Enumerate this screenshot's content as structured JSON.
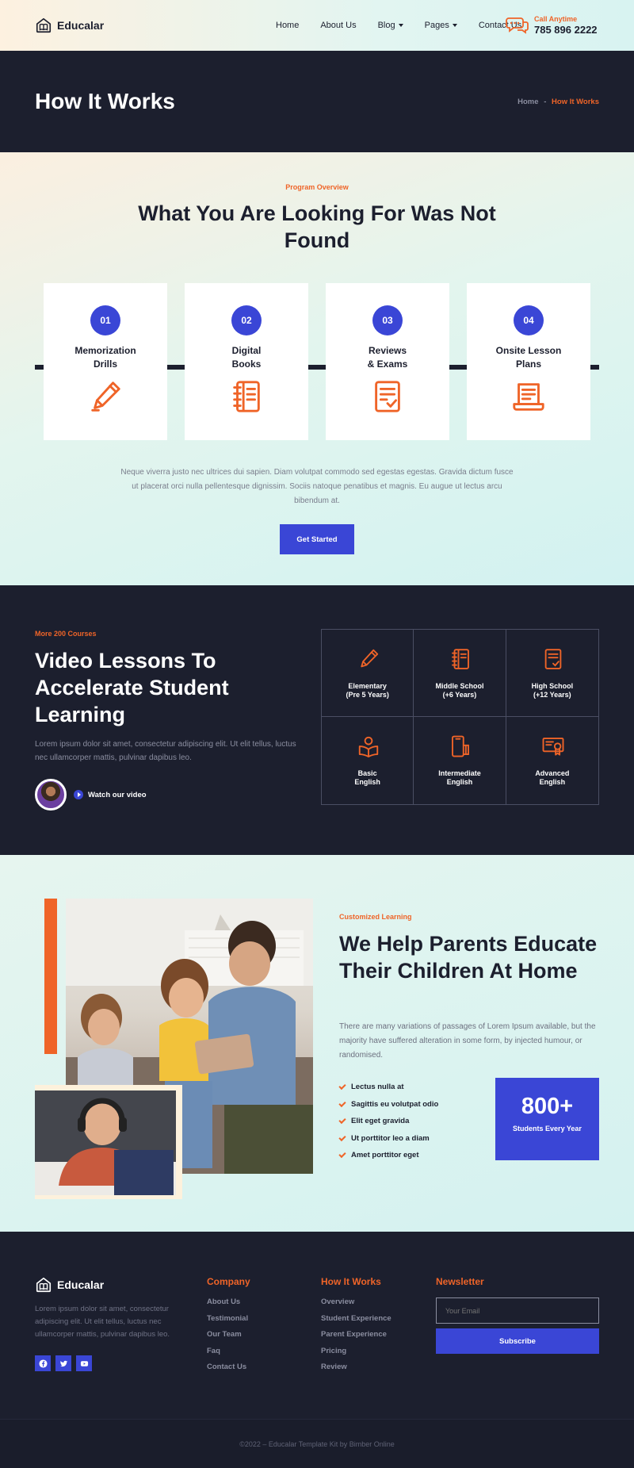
{
  "brand": {
    "name": "Educalar",
    "accent": "#ef6428",
    "primary": "#3a46d6",
    "dark": "#1c1f2e"
  },
  "nav": {
    "items": [
      {
        "label": "Home",
        "dropdown": false
      },
      {
        "label": "About Us",
        "dropdown": false
      },
      {
        "label": "Blog",
        "dropdown": true
      },
      {
        "label": "Pages",
        "dropdown": true
      },
      {
        "label": "Contact Us",
        "dropdown": false
      }
    ],
    "call_label": "Call Anytime",
    "call_number": "785 896 2222",
    "call_icon": "chat-bubbles-icon"
  },
  "hero": {
    "title": "How It Works",
    "breadcrumb_home": "Home",
    "breadcrumb_sep": "-",
    "breadcrumb_current": "How It Works"
  },
  "overview": {
    "eyebrow": "Program Overview",
    "title": "What You Are Looking For Was Not Found",
    "steps": [
      {
        "num": "01",
        "title": "Memorization Drills",
        "icon": "pencil-icon"
      },
      {
        "num": "02",
        "title": "Digital Books",
        "icon": "notebook-icon"
      },
      {
        "num": "03",
        "title": "Reviews & Exams",
        "icon": "checklist-icon"
      },
      {
        "num": "04",
        "title": "Onsite Lesson Plans",
        "icon": "laptop-book-icon"
      }
    ],
    "paragraph": "Neque viverra justo nec ultrices dui sapien. Diam volutpat commodo sed egestas egestas. Gravida dictum fusce ut placerat orci nulla pellentesque dignissim. Sociis natoque penatibus et magnis. Eu augue ut lectus arcu bibendum at.",
    "button": "Get Started"
  },
  "lessons": {
    "eyebrow": "More 200 Courses",
    "title": "Video Lessons To Accelerate Student Learning",
    "paragraph": "Lorem ipsum dolor sit amet, consectetur adipiscing elit. Ut elit tellus, luctus nec ullamcorper mattis, pulvinar dapibus leo.",
    "watch": "Watch our video",
    "courses": [
      {
        "line1": "Elementary",
        "line2": "(Pre 5 Years)",
        "icon": "pencil-icon"
      },
      {
        "line1": "Middle School",
        "line2": "(+6 Years)",
        "icon": "notebook-icon"
      },
      {
        "line1": "High School",
        "line2": "(+12 Years)",
        "icon": "checklist-icon"
      },
      {
        "line1": "Basic",
        "line2": "English",
        "icon": "reader-icon"
      },
      {
        "line1": "Intermediate",
        "line2": "English",
        "icon": "phone-book-icon"
      },
      {
        "line1": "Advanced",
        "line2": "English",
        "icon": "certificate-icon"
      }
    ]
  },
  "parents": {
    "eyebrow": "Customized Learning",
    "title": "We Help Parents Educate Their Children At Home",
    "paragraph": "There are many variations of passages of Lorem Ipsum available, but the majority have suffered alteration in some form, by injected humour, or randomised.",
    "checklist": [
      "Lectus nulla at",
      "Sagittis eu volutpat odio",
      "Elit eget gravida",
      "Ut porttitor leo a diam",
      "Amet porttitor eget"
    ],
    "stat_number": "800+",
    "stat_label": "Students Every Year"
  },
  "footer": {
    "about": "Lorem ipsum dolor sit amet, consectetur adipiscing elit. Ut elit tellus, luctus nec ullamcorper mattis, pulvinar dapibus leo.",
    "socials": [
      "facebook-icon",
      "twitter-icon",
      "youtube-icon"
    ],
    "company_title": "Company",
    "company_links": [
      "About Us",
      "Testimonial",
      "Our Team",
      "Faq",
      "Contact Us"
    ],
    "how_title": "How It Works",
    "how_links": [
      "Overview",
      "Student Experience",
      "Parent Experience",
      "Pricing",
      "Review"
    ],
    "newsletter_title": "Newsletter",
    "email_placeholder": "Your Email",
    "subscribe": "Subscribe",
    "copyright": "©2022 – Educalar Template Kit by Bimber Online"
  }
}
